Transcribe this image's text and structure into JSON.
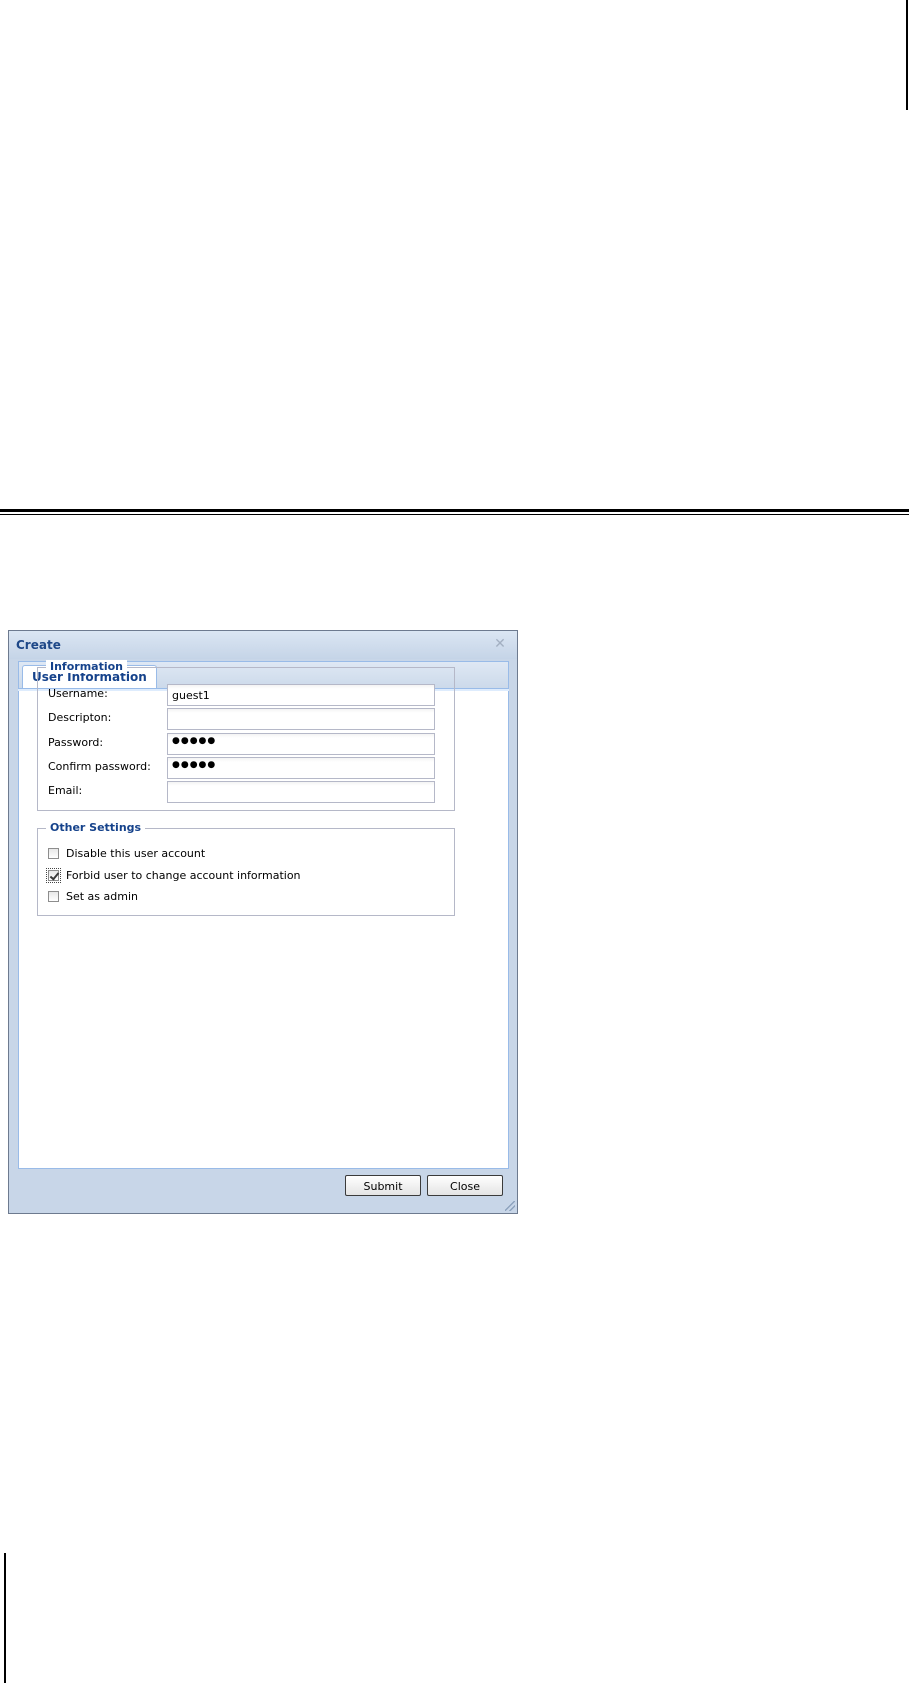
{
  "dialog": {
    "title": "Create",
    "close_icon": "close-icon",
    "tab_label": "User Information"
  },
  "information": {
    "legend": "Information",
    "fields": [
      {
        "label": "Username:",
        "value": "guest1",
        "type": "text"
      },
      {
        "label": "Descripton:",
        "value": "",
        "type": "text"
      },
      {
        "label": "Password:",
        "value": "●●●●●",
        "type": "password"
      },
      {
        "label": "Confirm password:",
        "value": "●●●●●",
        "type": "password"
      },
      {
        "label": "Email:",
        "value": "",
        "type": "text"
      }
    ]
  },
  "other_settings": {
    "legend": "Other Settings",
    "options": [
      {
        "label": "Disable this user account",
        "checked": false
      },
      {
        "label": "Forbid user to change account information",
        "checked": true
      },
      {
        "label": "Set as admin",
        "checked": false
      }
    ]
  },
  "buttons": {
    "submit_label": "Submit",
    "close_label": "Close"
  },
  "colors": {
    "title_text": "#1e4888",
    "legend_text": "#15428b",
    "window_bg": "#c8d6e8",
    "panel_border": "#99bbe8"
  }
}
